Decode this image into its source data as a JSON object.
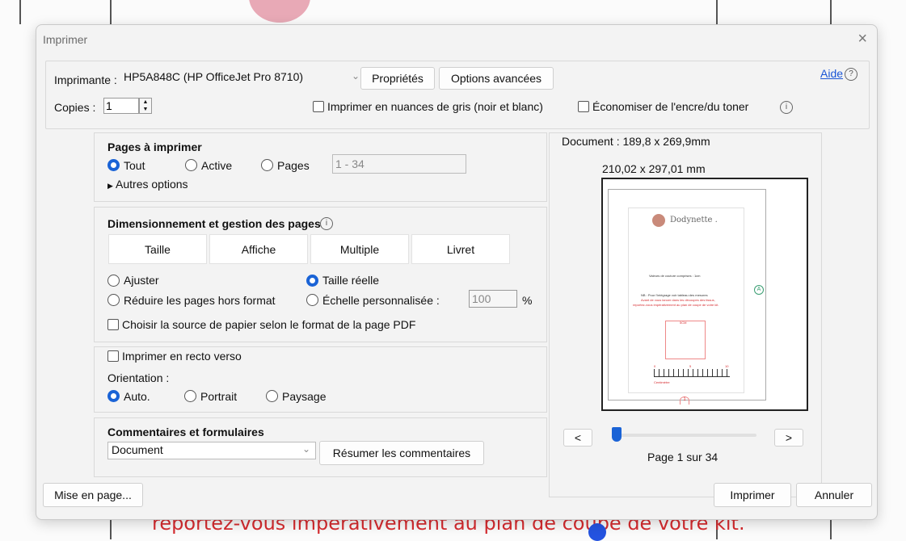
{
  "background": {
    "bottom_text": "reportez-vous impérativement au plan de coupe de votre kit."
  },
  "dialog": {
    "title": "Imprimer",
    "close": "×"
  },
  "printer": {
    "label": "Imprimante :",
    "selected": "HP5A848C (HP OfficeJet Pro 8710)",
    "properties_button": "Propriétés",
    "advanced_button": "Options avancées",
    "help_link": "Aide",
    "help_icon": "?"
  },
  "copies": {
    "label": "Copies :",
    "value": "1",
    "grayscale_label": "Imprimer en nuances de gris (noir et blanc)",
    "grayscale_checked": false,
    "save_ink_label": "Économiser de l'encre/du toner",
    "save_ink_checked": false,
    "info_icon": "i"
  },
  "pages_to_print": {
    "title": "Pages à imprimer",
    "options": [
      "Tout",
      "Active",
      "Pages"
    ],
    "selected": "Tout",
    "range_placeholder": "1 - 34",
    "more_options": "Autres options"
  },
  "sizing": {
    "title": "Dimensionnement et gestion des pages",
    "info_icon": "i",
    "tabs": [
      "Taille",
      "Affiche",
      "Multiple",
      "Livret"
    ],
    "active_tab": "Taille",
    "fit_label": "Ajuster",
    "actual_size_label": "Taille réelle",
    "shrink_label": "Réduire les pages hors format",
    "custom_scale_label": "Échelle personnalisée :",
    "scale_value": "100",
    "scale_unit": "%",
    "paper_source_label": "Choisir la source de papier selon le format de la page PDF",
    "selected": "Taille réelle"
  },
  "duplex": {
    "label": "Imprimer en recto verso",
    "checked": false,
    "orientation_label": "Orientation :",
    "options": [
      "Auto.",
      "Portrait",
      "Paysage"
    ],
    "selected": "Auto."
  },
  "comments": {
    "title": "Commentaires et formulaires",
    "selected": "Document",
    "summarize_button": "Résumer les commentaires"
  },
  "preview": {
    "document_size": "Document : 189,8 x 269,9mm",
    "paper_size": "210,02 x 297,01 mm",
    "prev_button": "<",
    "next_button": ">",
    "page_label": "Page 1 sur 34",
    "current_page": 1,
    "total_pages": 34,
    "thumb": {
      "brand": "Dodynette .",
      "line1": "Valeurs de couture comprises : 1cm",
      "line2": "NB : Pour l'intégrage voir tableau des mesures",
      "line3": "Avant de vous lancer dans les découpes des tissus,",
      "line4": "reportez-vous impérativement au plan de coupe de votre kit.",
      "marker": "A",
      "square_label": "5CM",
      "ruler_left": "0",
      "ruler_mid": "5",
      "ruler_right": "10",
      "ruler_unit": "Centimètre",
      "page_num": "1"
    }
  },
  "footer": {
    "page_setup_button": "Mise en page...",
    "print_button": "Imprimer",
    "cancel_button": "Annuler"
  }
}
